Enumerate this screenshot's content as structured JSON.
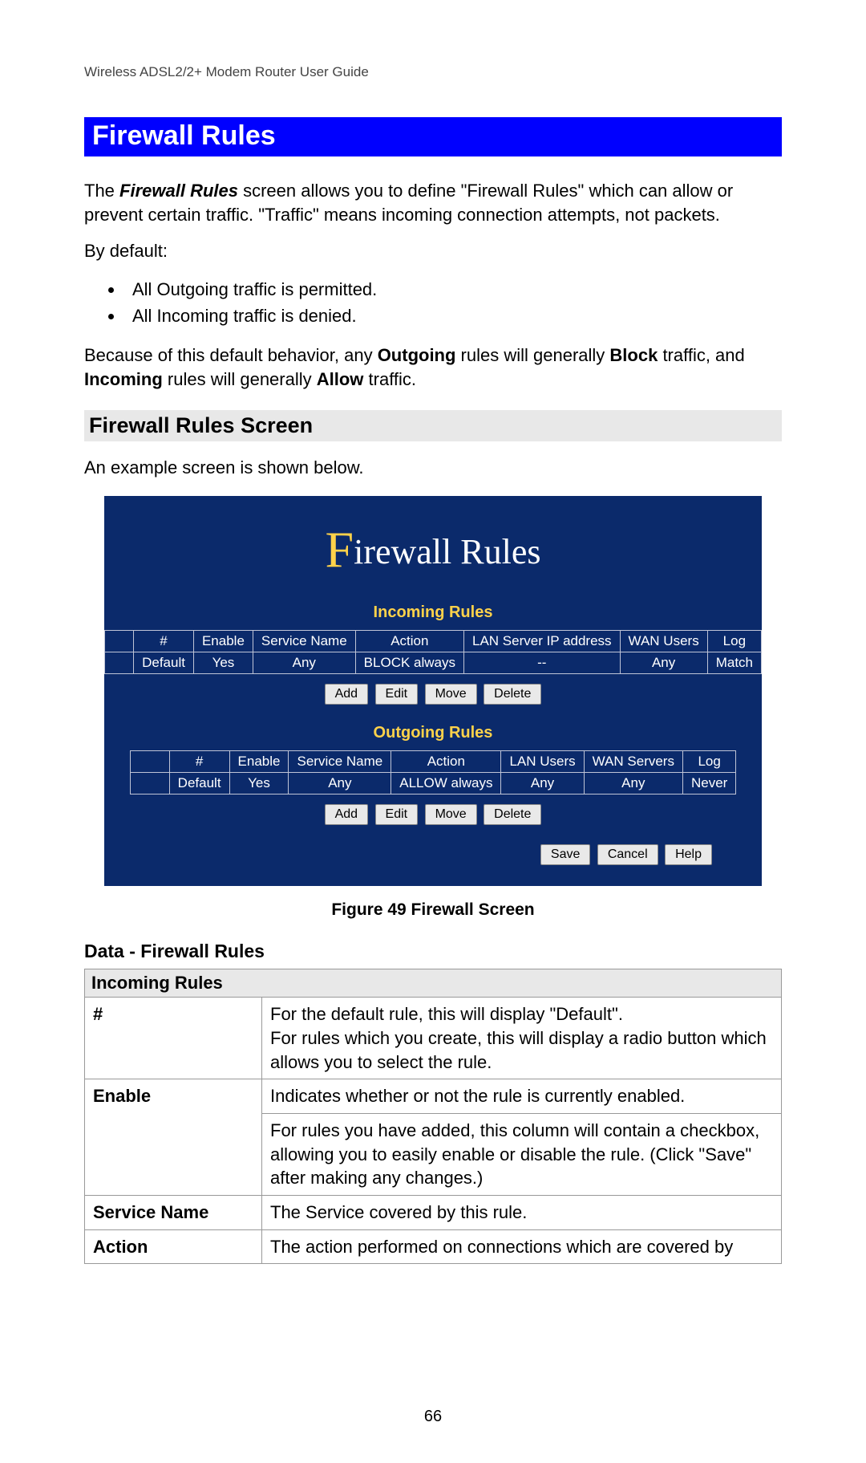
{
  "header": {
    "running": "Wireless ADSL2/2+ Modem Router User Guide"
  },
  "title": "Firewall Rules",
  "intro": {
    "pre": "The ",
    "bold1": "Firewall Rules",
    "post1": " screen allows you to define \"Firewall Rules\" which can allow or prevent certain traffic. \"Traffic\" means incoming connection attempts, not packets."
  },
  "by_default": "By default:",
  "bullets": {
    "b1": "All Outgoing traffic is permitted.",
    "b2": "All Incoming traffic is denied."
  },
  "because_line": {
    "t1": "Because of this default behavior, any ",
    "b1": "Outgoing",
    "t2": " rules will generally ",
    "b2": "Block",
    "t3": " traffic, and ",
    "b3": "Incoming",
    "t4": " rules will generally ",
    "b4": "Allow",
    "t5": " traffic."
  },
  "subsection": "Firewall Rules Screen",
  "example_line": "An example screen is shown below.",
  "app": {
    "title_big": "F",
    "title_rest": "irewall Rules",
    "incoming_label": "Incoming Rules",
    "outgoing_label": "Outgoing Rules",
    "incoming": {
      "headers": {
        "c1": "#",
        "c2": "Enable",
        "c3": "Service Name",
        "c4": "Action",
        "c5": "LAN Server IP address",
        "c6": "WAN Users",
        "c7": "Log"
      },
      "row": {
        "c0": "",
        "c1": "Default",
        "c2": "Yes",
        "c3": "Any",
        "c4": "BLOCK always",
        "c5": "--",
        "c6": "Any",
        "c7": "Match"
      }
    },
    "outgoing": {
      "headers": {
        "c1": "#",
        "c2": "Enable",
        "c3": "Service Name",
        "c4": "Action",
        "c5": "LAN Users",
        "c6": "WAN Servers",
        "c7": "Log"
      },
      "row": {
        "c0": "",
        "c1": "Default",
        "c2": "Yes",
        "c3": "Any",
        "c4": "ALLOW always",
        "c5": "Any",
        "c6": "Any",
        "c7": "Never"
      }
    },
    "buttons": {
      "add": "Add",
      "edit": "Edit",
      "move": "Move",
      "delete": "Delete",
      "save": "Save",
      "cancel": "Cancel",
      "help": "Help"
    }
  },
  "figure_caption": "Figure 49 Firewall Screen",
  "data_heading": "Data - Firewall Rules",
  "data_table": {
    "section1": "Incoming Rules",
    "r1": {
      "k": "#",
      "v": "For the default rule, this will display \"Default\".\nFor rules which you create, this will display a radio button which allows you to select the rule."
    },
    "r2": {
      "k": "Enable",
      "v1": "Indicates whether or not the rule is currently enabled.",
      "v2": "For rules you have added, this column will contain a checkbox, allowing you to easily enable or disable the rule. (Click \"Save\" after making any changes.)"
    },
    "r3": {
      "k": "Service Name",
      "v": "The Service covered by this rule."
    },
    "r4": {
      "k": "Action",
      "v": "The action performed on connections which are covered by"
    }
  },
  "page_number": "66"
}
